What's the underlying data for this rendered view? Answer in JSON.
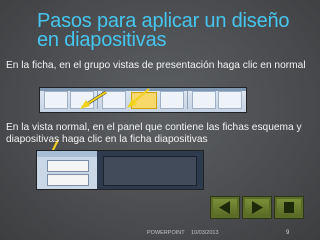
{
  "title": {
    "line1": "Pasos para aplicar un diseño",
    "line2": "en diapositivas"
  },
  "body": {
    "paragraph1": "En la ficha, en el grupo vistas de presentación haga clic en normal",
    "paragraph2": "En la vista normal, en el panel que contiene las fichas esquema y diapositivas haga clic en la ficha diapositivas"
  },
  "navigation": {
    "icons": [
      "left-triangle-icon",
      "right-triangle-icon",
      "home-square-icon"
    ]
  },
  "footer": {
    "left": "POWERPOINT",
    "date": "10/03/2013",
    "page_number": "9"
  },
  "colors": {
    "title": "#46c6ee",
    "background": "#4a4c4f",
    "arrow": "#f2d21a",
    "nav_button": "#5b6b2a"
  }
}
